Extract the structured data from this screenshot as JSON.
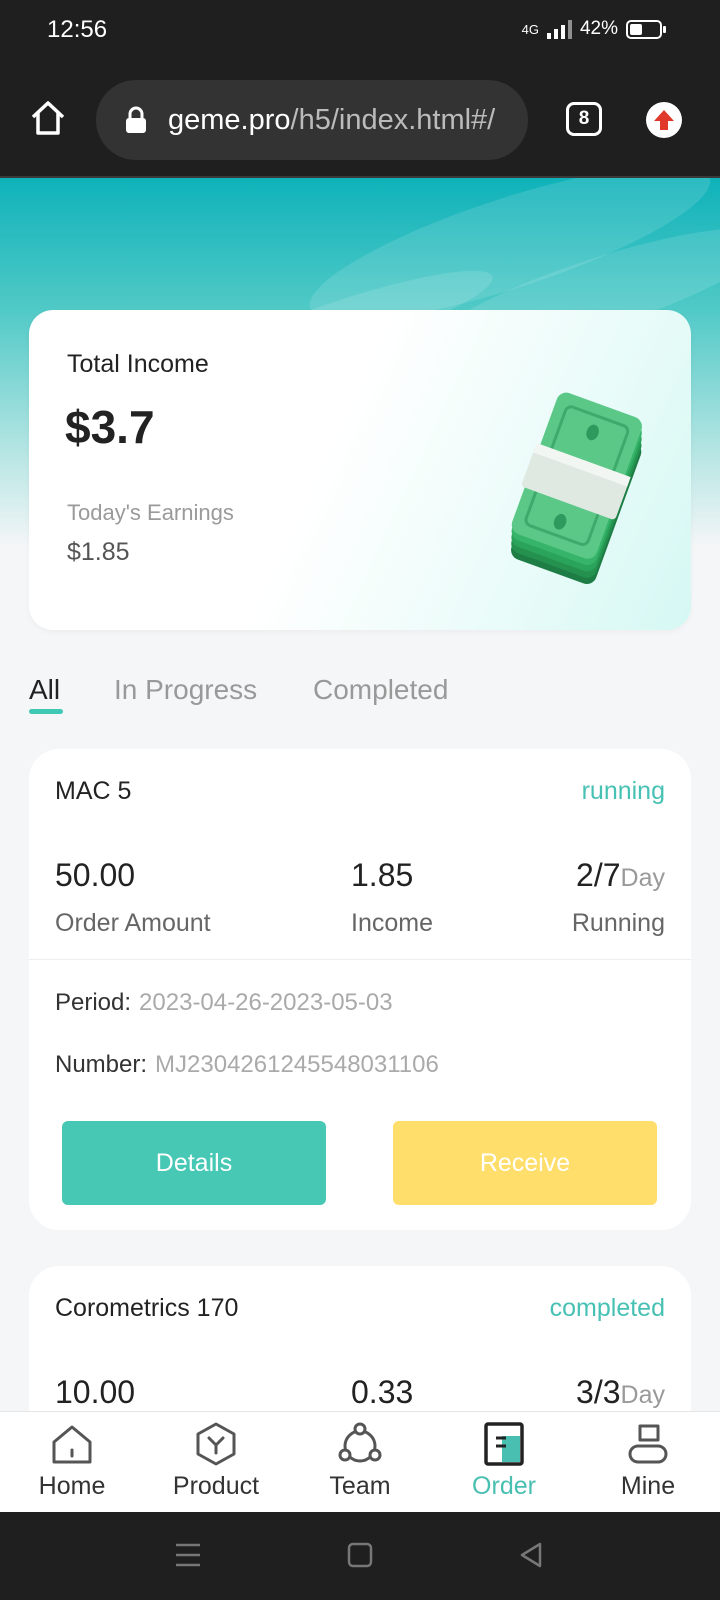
{
  "status_bar": {
    "time": "12:56",
    "network": "4G",
    "battery": "42%"
  },
  "browser": {
    "url_host": "geme.pro",
    "url_path": "/h5/index.html#/",
    "tab_count": "8"
  },
  "income": {
    "total_label": "Total Income",
    "total_value": "$3.7",
    "today_label": "Today's Earnings",
    "today_value": "$1.85"
  },
  "tabs": [
    "All",
    "In Progress",
    "Completed"
  ],
  "orders": [
    {
      "name": "MAC 5",
      "status": "running",
      "amount": "50.00",
      "amount_label": "Order Amount",
      "income": "1.85",
      "income_label": "Income",
      "days": "2/7",
      "days_unit": "Day",
      "days_label": "Running",
      "period_label": "Period:",
      "period": "2023-04-26-2023-05-03",
      "number_label": "Number:",
      "number": "MJ2304261245548031106",
      "details_label": "Details",
      "receive_label": "Receive"
    },
    {
      "name": "Corometrics 170",
      "status": "completed",
      "amount": "10.00",
      "income": "0.33",
      "days": "3/3",
      "days_unit": "Day"
    }
  ],
  "nav": {
    "items": [
      "Home",
      "Product",
      "Team",
      "Order",
      "Mine"
    ],
    "active": "Order",
    "icons": [
      "home-icon",
      "product-icon",
      "team-icon",
      "order-icon",
      "mine-icon"
    ]
  },
  "colors": {
    "accent": "#47c1b4",
    "receive": "#ffde6b",
    "details": "#46c8b5"
  }
}
